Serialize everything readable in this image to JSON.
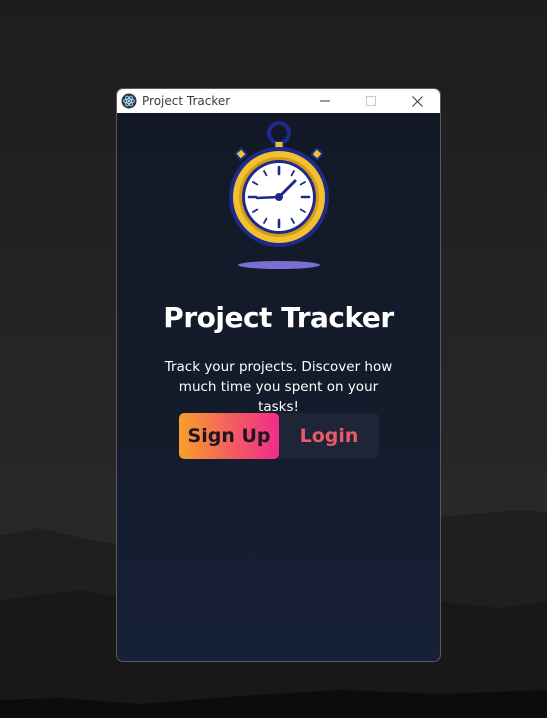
{
  "window": {
    "title": "Project Tracker"
  },
  "hero": {
    "heading": "Project Tracker",
    "tagline": "Track your projects. Discover how much time you spent on your tasks!"
  },
  "auth": {
    "signup_label": "Sign Up",
    "login_label": "Login"
  },
  "icons": {
    "app": "electron-atom-icon",
    "minimize": "minimize-icon",
    "maximize": "maximize-icon",
    "close": "close-icon",
    "hero": "stopwatch-icon"
  },
  "colors": {
    "window_bg": "#121826",
    "titlebar_bg": "#ffffff",
    "signup_gradient_start": "#f7a02a",
    "signup_gradient_end": "#ef2e8a",
    "login_text": "#e85a66",
    "stopwatch_gold": "#f2c12e",
    "stopwatch_navy": "#1d2a8a",
    "shadow_purple": "#7b6fd6"
  }
}
